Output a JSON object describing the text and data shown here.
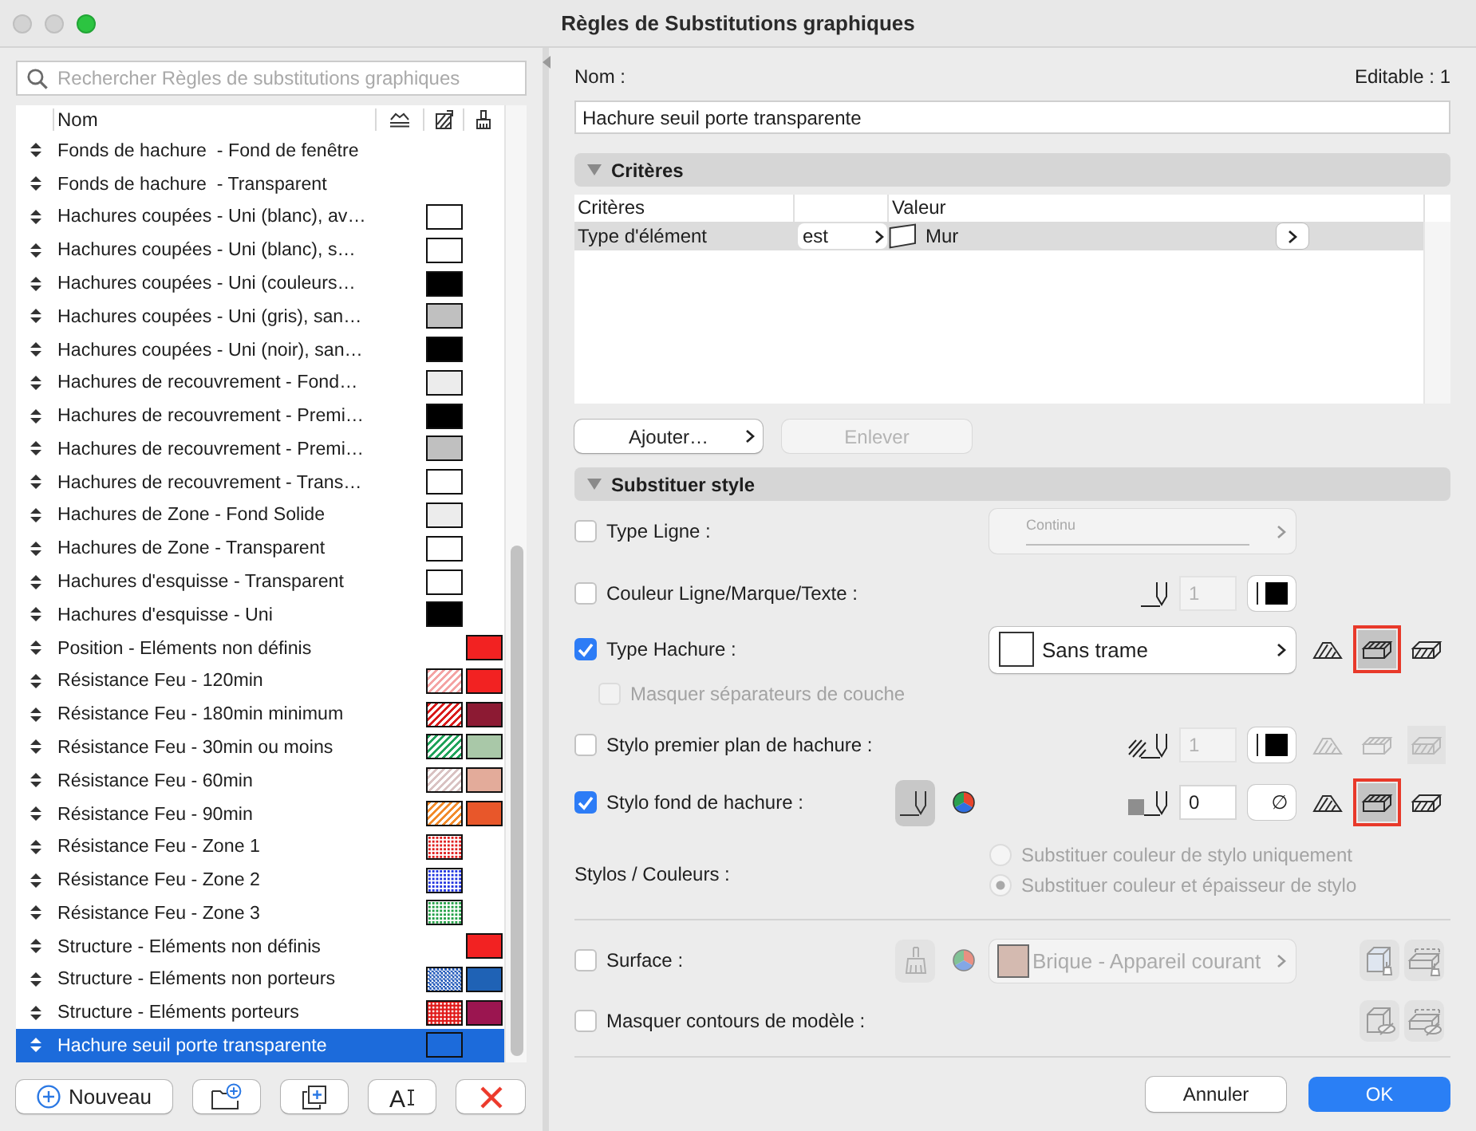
{
  "window": {
    "title": "Règles de Substitutions graphiques"
  },
  "sidebar": {
    "search": {
      "placeholder": "Rechercher Règles de substitutions graphiques"
    },
    "list_header": {
      "name_column": "Nom"
    },
    "rules": [
      {
        "name": "Fonds de hachure  - Fond de fenêtre",
        "selected": false
      },
      {
        "name": "Fonds de hachure  - Transparent",
        "selected": false
      },
      {
        "name": "Hachures coupées - Uni (blanc), av…",
        "selected": false,
        "hatch_swatch": {
          "kind": "solid",
          "color": "#ffffff"
        }
      },
      {
        "name": "Hachures coupées - Uni (blanc), s…",
        "selected": false,
        "hatch_swatch": {
          "kind": "solid",
          "color": "#ffffff"
        }
      },
      {
        "name": "Hachures coupées - Uni (couleurs…",
        "selected": false,
        "hatch_swatch": {
          "kind": "solid",
          "color": "#000000"
        }
      },
      {
        "name": "Hachures coupées - Uni (gris), san…",
        "selected": false,
        "hatch_swatch": {
          "kind": "solid",
          "color": "#c0c0c0"
        }
      },
      {
        "name": "Hachures coupées - Uni (noir), san…",
        "selected": false,
        "hatch_swatch": {
          "kind": "solid",
          "color": "#000000"
        }
      },
      {
        "name": "Hachures de recouvrement - Fond…",
        "selected": false,
        "hatch_swatch": {
          "kind": "solid",
          "color": "#ececec"
        }
      },
      {
        "name": "Hachures de recouvrement - Premi…",
        "selected": false,
        "hatch_swatch": {
          "kind": "solid",
          "color": "#000000"
        }
      },
      {
        "name": "Hachures de recouvrement - Premi…",
        "selected": false,
        "hatch_swatch": {
          "kind": "solid",
          "color": "#c0c0c0"
        }
      },
      {
        "name": "Hachures de recouvrement - Trans…",
        "selected": false,
        "hatch_swatch": {
          "kind": "solid",
          "color": "#ffffff"
        }
      },
      {
        "name": "Hachures de Zone - Fond Solide",
        "selected": false,
        "hatch_swatch": {
          "kind": "solid",
          "color": "#ececec"
        }
      },
      {
        "name": "Hachures de Zone - Transparent",
        "selected": false,
        "hatch_swatch": {
          "kind": "solid",
          "color": "#ffffff"
        }
      },
      {
        "name": "Hachures d'esquisse - Transparent",
        "selected": false,
        "hatch_swatch": {
          "kind": "solid",
          "color": "#ffffff"
        }
      },
      {
        "name": "Hachures d'esquisse - Uni",
        "selected": false,
        "hatch_swatch": {
          "kind": "solid",
          "color": "#000000"
        }
      },
      {
        "name": "Position - Eléments non définis",
        "selected": false,
        "color_swatch": {
          "kind": "solid",
          "color": "#f22222"
        }
      },
      {
        "name": "Résistance Feu - 120min",
        "selected": false,
        "hatch_swatch": {
          "kind": "stripes",
          "color": "#f4a3a3"
        },
        "color_swatch": {
          "kind": "solid",
          "color": "#f22222"
        }
      },
      {
        "name": "Résistance Feu - 180min minimum",
        "selected": false,
        "hatch_swatch": {
          "kind": "stripes",
          "color": "#d91a1a"
        },
        "color_swatch": {
          "kind": "solid",
          "color": "#8c1a33"
        }
      },
      {
        "name": "Résistance Feu - 30min ou moins",
        "selected": false,
        "hatch_swatch": {
          "kind": "stripes",
          "color": "#1fa35a"
        },
        "color_swatch": {
          "kind": "solid",
          "color": "#a9c8a8"
        }
      },
      {
        "name": "Résistance Feu - 60min",
        "selected": false,
        "hatch_swatch": {
          "kind": "stripes",
          "color": "#d9c2c2"
        },
        "color_swatch": {
          "kind": "solid",
          "color": "#e3ab9a"
        }
      },
      {
        "name": "Résistance Feu - 90min",
        "selected": false,
        "hatch_swatch": {
          "kind": "stripes",
          "color": "#f28a2a"
        },
        "color_swatch": {
          "kind": "solid",
          "color": "#e8572a"
        }
      },
      {
        "name": "Résistance Feu - Zone 1",
        "selected": false,
        "hatch_swatch": {
          "kind": "dots",
          "color": "#e02020"
        }
      },
      {
        "name": "Résistance Feu - Zone 2",
        "selected": false,
        "hatch_swatch": {
          "kind": "dots",
          "color": "#2033e0"
        }
      },
      {
        "name": "Résistance Feu - Zone 3",
        "selected": false,
        "hatch_swatch": {
          "kind": "dots",
          "color": "#22a045"
        }
      },
      {
        "name": "Structure - Eléments non définis",
        "selected": false,
        "color_swatch": {
          "kind": "solid",
          "color": "#f22222"
        }
      },
      {
        "name": "Structure - Eléments non porteurs",
        "selected": false,
        "hatch_swatch": {
          "kind": "checker",
          "color": "#1e56b8"
        },
        "color_swatch": {
          "kind": "solid",
          "color": "#1f62b5"
        }
      },
      {
        "name": "Structure - Eléments porteurs",
        "selected": false,
        "hatch_swatch": {
          "kind": "dense-dots",
          "color": "#e01818"
        },
        "color_swatch": {
          "kind": "solid",
          "color": "#9b1550"
        }
      },
      {
        "name": "Hachure seuil porte transparente",
        "selected": true,
        "hatch_swatch": {
          "kind": "empty"
        }
      }
    ],
    "buttons": [
      {
        "kind": "new",
        "label": "Nouveau"
      },
      {
        "kind": "new-folder"
      },
      {
        "kind": "duplicate"
      },
      {
        "kind": "rename",
        "label": "A"
      },
      {
        "kind": "delete"
      }
    ]
  },
  "editor": {
    "name_label": "Nom :",
    "editable_count": "Editable : 1",
    "name_field": {
      "value": "Hachure seuil porte transparente"
    },
    "criteria": {
      "title": "Critères",
      "expanded": true,
      "columns": [
        "Critères",
        "Valeur"
      ],
      "rows": [
        {
          "criterion": "Type d'élément",
          "operator": "est",
          "value": "Mur",
          "selected": true
        }
      ],
      "buttons": [
        {
          "label": "Ajouter…",
          "disabled": false,
          "menu": true
        },
        {
          "label": "Enlever",
          "disabled": true,
          "menu": false
        }
      ]
    },
    "style": {
      "title": "Substituer style",
      "expanded": true,
      "options": [
        {
          "kind": "line-type",
          "label": "Type Ligne :",
          "checked": false,
          "value": "Continu"
        },
        {
          "kind": "pen-color",
          "label": "Couleur Ligne/Marque/Texte :",
          "checked": false,
          "pen_number": "1"
        },
        {
          "kind": "fill-type",
          "label": "Type Hachure :",
          "checked": true,
          "value": "Sans trame",
          "modes": [
            {
              "kind": "section",
              "selected": false,
              "highlighted": false
            },
            {
              "kind": "top",
              "selected": true,
              "highlighted": true
            },
            {
              "kind": "front",
              "selected": false,
              "highlighted": false
            }
          ]
        },
        {
          "kind": "sub-check",
          "label": "Masquer séparateurs de couche",
          "checked": false,
          "disabled": true
        },
        {
          "kind": "fg-pen",
          "label": "Stylo premier plan de hachure :",
          "checked": false,
          "pen_number": "1",
          "modes": [
            {
              "kind": "section",
              "selected": false,
              "highlighted": false
            },
            {
              "kind": "top",
              "selected": false,
              "highlighted": false
            },
            {
              "kind": "front",
              "selected": true,
              "highlighted": false
            }
          ]
        },
        {
          "kind": "bg-pen",
          "label": "Stylo fond de hachure :",
          "checked": true,
          "pen_number": "0",
          "no_color": "∅",
          "modes": [
            {
              "kind": "section",
              "selected": false,
              "highlighted": false
            },
            {
              "kind": "top",
              "selected": true,
              "highlighted": true
            },
            {
              "kind": "front",
              "selected": false,
              "highlighted": false
            }
          ]
        },
        {
          "kind": "radio-group",
          "label": "Stylos / Couleurs :",
          "disabled": true,
          "choices": [
            {
              "label": "Substituer couleur de stylo uniquement",
              "selected": false
            },
            {
              "label": "Substituer couleur et épaisseur de stylo",
              "selected": true
            }
          ]
        }
      ]
    },
    "model_options": [
      {
        "kind": "surface",
        "label": "Surface :",
        "checked": false,
        "value": "Brique - Appareil courant"
      },
      {
        "kind": "hide-contours",
        "label": "Masquer contours de modèle :",
        "checked": false
      }
    ]
  },
  "footer": {
    "buttons": [
      {
        "kind": "cancel",
        "label": "Annuler"
      },
      {
        "kind": "default",
        "label": "OK"
      }
    ]
  }
}
